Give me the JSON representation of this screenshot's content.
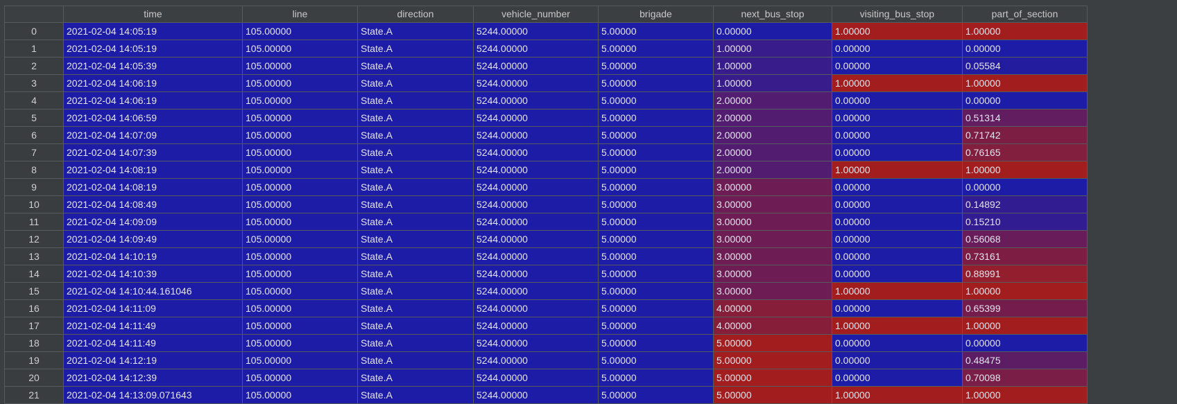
{
  "table": {
    "columns": [
      "time",
      "line",
      "direction",
      "vehicle_number",
      "brigade",
      "next_bus_stop",
      "visiting_bus_stop",
      "part_of_section"
    ],
    "index": [
      "0",
      "1",
      "2",
      "3",
      "4",
      "5",
      "6",
      "7",
      "8",
      "9",
      "10",
      "11",
      "12",
      "13",
      "14",
      "15",
      "16",
      "17",
      "18",
      "19",
      "20",
      "21"
    ],
    "rows": [
      [
        "2021-02-04 14:05:19",
        "105.00000",
        "State.A",
        "5244.00000",
        "5.00000",
        "0.00000",
        "1.00000",
        "1.00000"
      ],
      [
        "2021-02-04 14:05:19",
        "105.00000",
        "State.A",
        "5244.00000",
        "5.00000",
        "1.00000",
        "0.00000",
        "0.00000"
      ],
      [
        "2021-02-04 14:05:39",
        "105.00000",
        "State.A",
        "5244.00000",
        "5.00000",
        "1.00000",
        "0.00000",
        "0.05584"
      ],
      [
        "2021-02-04 14:06:19",
        "105.00000",
        "State.A",
        "5244.00000",
        "5.00000",
        "1.00000",
        "1.00000",
        "1.00000"
      ],
      [
        "2021-02-04 14:06:19",
        "105.00000",
        "State.A",
        "5244.00000",
        "5.00000",
        "2.00000",
        "0.00000",
        "0.00000"
      ],
      [
        "2021-02-04 14:06:59",
        "105.00000",
        "State.A",
        "5244.00000",
        "5.00000",
        "2.00000",
        "0.00000",
        "0.51314"
      ],
      [
        "2021-02-04 14:07:09",
        "105.00000",
        "State.A",
        "5244.00000",
        "5.00000",
        "2.00000",
        "0.00000",
        "0.71742"
      ],
      [
        "2021-02-04 14:07:39",
        "105.00000",
        "State.A",
        "5244.00000",
        "5.00000",
        "2.00000",
        "0.00000",
        "0.76165"
      ],
      [
        "2021-02-04 14:08:19",
        "105.00000",
        "State.A",
        "5244.00000",
        "5.00000",
        "2.00000",
        "1.00000",
        "1.00000"
      ],
      [
        "2021-02-04 14:08:19",
        "105.00000",
        "State.A",
        "5244.00000",
        "5.00000",
        "3.00000",
        "0.00000",
        "0.00000"
      ],
      [
        "2021-02-04 14:08:49",
        "105.00000",
        "State.A",
        "5244.00000",
        "5.00000",
        "3.00000",
        "0.00000",
        "0.14892"
      ],
      [
        "2021-02-04 14:09:09",
        "105.00000",
        "State.A",
        "5244.00000",
        "5.00000",
        "3.00000",
        "0.00000",
        "0.15210"
      ],
      [
        "2021-02-04 14:09:49",
        "105.00000",
        "State.A",
        "5244.00000",
        "5.00000",
        "3.00000",
        "0.00000",
        "0.56068"
      ],
      [
        "2021-02-04 14:10:19",
        "105.00000",
        "State.A",
        "5244.00000",
        "5.00000",
        "3.00000",
        "0.00000",
        "0.73161"
      ],
      [
        "2021-02-04 14:10:39",
        "105.00000",
        "State.A",
        "5244.00000",
        "5.00000",
        "3.00000",
        "0.00000",
        "0.88991"
      ],
      [
        "2021-02-04 14:10:44.161046",
        "105.00000",
        "State.A",
        "5244.00000",
        "5.00000",
        "3.00000",
        "1.00000",
        "1.00000"
      ],
      [
        "2021-02-04 14:11:09",
        "105.00000",
        "State.A",
        "5244.00000",
        "5.00000",
        "4.00000",
        "0.00000",
        "0.65399"
      ],
      [
        "2021-02-04 14:11:49",
        "105.00000",
        "State.A",
        "5244.00000",
        "5.00000",
        "4.00000",
        "1.00000",
        "1.00000"
      ],
      [
        "2021-02-04 14:11:49",
        "105.00000",
        "State.A",
        "5244.00000",
        "5.00000",
        "5.00000",
        "0.00000",
        "0.00000"
      ],
      [
        "2021-02-04 14:12:19",
        "105.00000",
        "State.A",
        "5244.00000",
        "5.00000",
        "5.00000",
        "0.00000",
        "0.48475"
      ],
      [
        "2021-02-04 14:12:39",
        "105.00000",
        "State.A",
        "5244.00000",
        "5.00000",
        "5.00000",
        "0.00000",
        "0.70098"
      ],
      [
        "2021-02-04 14:13:09.071643",
        "105.00000",
        "State.A",
        "5244.00000",
        "5.00000",
        "5.00000",
        "1.00000",
        "1.00000"
      ]
    ]
  },
  "colors": {
    "low": "#1d1ca6",
    "high": "#a21e1e",
    "background": "#3c3f41",
    "grid": "#555a5d"
  }
}
